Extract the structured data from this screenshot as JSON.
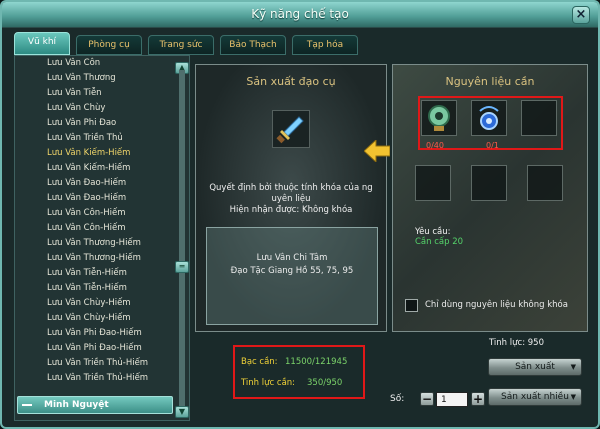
{
  "window": {
    "title": "Kỹ năng chế tạo",
    "close_glyph": "×"
  },
  "tabs": [
    {
      "label": "Vũ khí",
      "active": true
    },
    {
      "label": "Phòng cụ",
      "active": false
    },
    {
      "label": "Trang sức",
      "active": false
    },
    {
      "label": "Bảo Thạch",
      "active": false
    },
    {
      "label": "Tạp hóa",
      "active": false
    }
  ],
  "recipe_list": {
    "items": [
      {
        "label": "Lưu Vân Côn",
        "highlighted": false
      },
      {
        "label": "Lưu Vân Thương",
        "highlighted": false
      },
      {
        "label": "Lưu Vân Tiễn",
        "highlighted": false
      },
      {
        "label": "Lưu Vân Chùy",
        "highlighted": false
      },
      {
        "label": "Lưu Vân Phi Đao",
        "highlighted": false
      },
      {
        "label": "Lưu Vân Triền Thủ",
        "highlighted": false
      },
      {
        "label": "Lưu Vân Kiếm-Hiếm",
        "highlighted": true
      },
      {
        "label": "Lưu Vân Kiếm-Hiếm",
        "highlighted": false
      },
      {
        "label": "Lưu Vân Đao-Hiếm",
        "highlighted": false
      },
      {
        "label": "Lưu Vân Đao-Hiếm",
        "highlighted": false
      },
      {
        "label": "Lưu Vân Côn-Hiếm",
        "highlighted": false
      },
      {
        "label": "Lưu Vân Côn-Hiếm",
        "highlighted": false
      },
      {
        "label": "Lưu Vân Thương-Hiếm",
        "highlighted": false
      },
      {
        "label": "Lưu Vân Thương-Hiếm",
        "highlighted": false
      },
      {
        "label": "Lưu Vân Tiễn-Hiếm",
        "highlighted": false
      },
      {
        "label": "Lưu Vân Tiễn-Hiếm",
        "highlighted": false
      },
      {
        "label": "Lưu Vân Chùy-Hiếm",
        "highlighted": false
      },
      {
        "label": "Lưu Vân Chùy-Hiếm",
        "highlighted": false
      },
      {
        "label": "Lưu Vân Phi Đao-Hiếm",
        "highlighted": false
      },
      {
        "label": "Lưu Vân Phi Đao-Hiếm",
        "highlighted": false
      },
      {
        "label": "Lưu Vân Triền Thủ-Hiếm",
        "highlighted": false
      },
      {
        "label": "Lưu Vân Triền Thủ-Hiếm",
        "highlighted": false
      }
    ],
    "group_label": "Minh Nguyệt",
    "scroll_up_glyph": "▲",
    "scroll_down_glyph": "▼",
    "scroll_thumb_glyph": "═"
  },
  "production": {
    "title": "Sản xuất đạo cụ",
    "product_icon": "sword-icon",
    "bind_note_line1": "Quyết định bởi thuộc tính khóa của ng",
    "bind_note_line2": "uyên liệu",
    "bind_note_line3": "Hiện nhận được: Không khóa",
    "result_name": "Lưu Vân Chi Tâm",
    "result_source": "Đạo Tặc Giang Hồ 55, 75, 95"
  },
  "materials": {
    "title": "Nguyên liệu cần",
    "slots": [
      {
        "icon": "jade-orb-icon",
        "count": "0/40"
      },
      {
        "icon": "blue-pendant-icon",
        "count": "0/1"
      },
      {
        "icon": "empty-slot",
        "count": ""
      }
    ],
    "requirement_label": "Yêu cầu:",
    "requirement_value": "Cần cấp 20",
    "only_unbound_label": "Chỉ dùng nguyên liệu không khóa",
    "only_unbound_checked": false
  },
  "costs": {
    "silver_label": "Bạc cần:",
    "silver_value": "11500/121945",
    "energy_label": "Tinh lực cần:",
    "energy_value": "350/950"
  },
  "energy_stat": "Tinh lực: 950",
  "actions": {
    "produce_label": "Sản xuất",
    "produce_many_label": "Sản xuất nhiều",
    "dropdown_glyph": "▼",
    "quantity_label": "Số:",
    "quantity_value": "1",
    "minus_glyph": "−",
    "plus_glyph": "+"
  },
  "colors": {
    "frame": "#6fb7b0",
    "tab_text": "#e9c26b",
    "highlight_list_item": "#f0d56a",
    "cost_label": "#f0d238",
    "cost_value": "#7bd36a",
    "material_count": "#ff5a4a",
    "annotation_box": "#e01818",
    "arrow": "#f2c230"
  }
}
